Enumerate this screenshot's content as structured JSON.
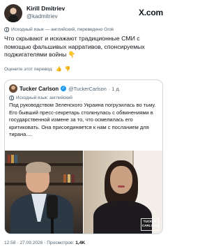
{
  "author": {
    "name": "Kirill Dmitriev",
    "handle": "@kadmitriev"
  },
  "brand": "X.com",
  "translation_note": "Исходный язык — английский, переведено Grok",
  "tweet_text": "Что скрывают и искажают традиционные СМИ с помощью фальшивых нарративов, спонсируемых поджигателями войны 👇",
  "rate_translation": "Оцените этот перевод:",
  "quoted": {
    "name": "Tucker Carlson",
    "handle": "@TuckerCarlson",
    "time": "· 1 д.",
    "translation_note": "Исходный язык: английский",
    "text": "Под руководством Зеленского Украина погрузилась во тьму. Его бывший пресс-секретарь столкнулась с обвинениями в государственной измене за то, что осмелилась его критиковать. Она присоединяется к нам с посланием для тирана....",
    "badge_text": "TUCKER CARLSON"
  },
  "meta": {
    "timestamp": "12:58 · 27.09.2026",
    "views_label": "· Просмотров:",
    "views_value": "1,4K"
  }
}
